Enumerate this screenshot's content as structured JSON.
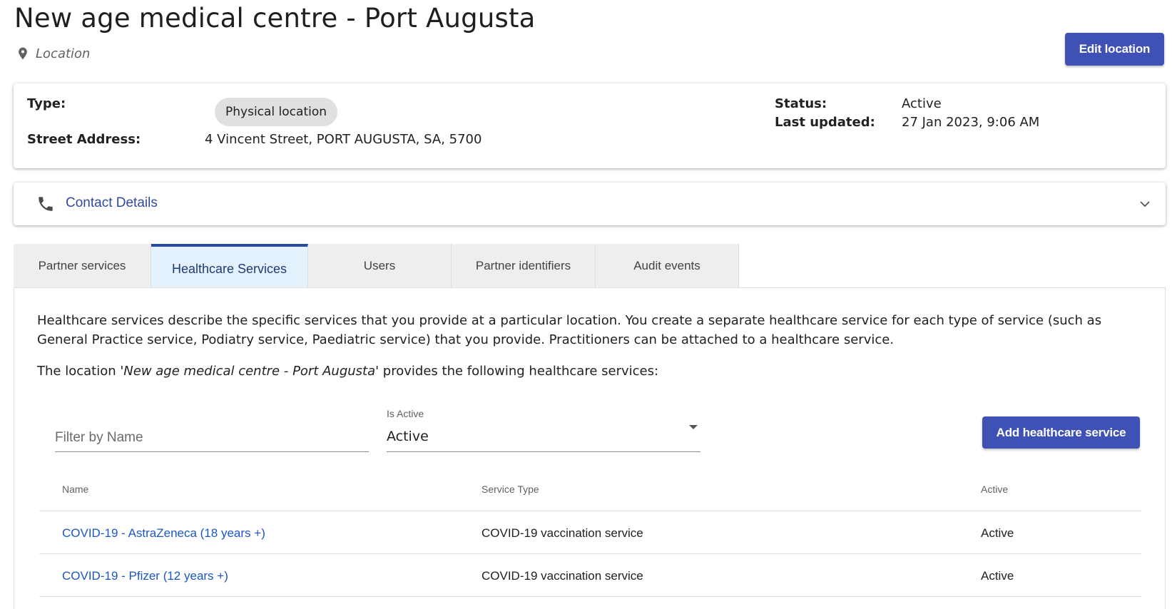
{
  "header": {
    "title": "New age medical centre - Port Augusta",
    "subtitle": "Location",
    "edit_button": "Edit location"
  },
  "info": {
    "type_label": "Type:",
    "type_value": "Physical location",
    "address_label": "Street Address:",
    "address_value": "4 Vincent Street, PORT AUGUSTA, SA, 5700",
    "status_label": "Status:",
    "status_value": "Active",
    "updated_label": "Last updated:",
    "updated_value": "27 Jan 2023, 9:06 AM"
  },
  "contact": {
    "label": "Contact Details"
  },
  "tabs": [
    {
      "label": "Partner services"
    },
    {
      "label": "Healthcare Services"
    },
    {
      "label": "Users"
    },
    {
      "label": "Partner identifiers"
    },
    {
      "label": "Audit events"
    }
  ],
  "active_tab": "Healthcare Services",
  "panel": {
    "description": "Healthcare services describe the specific services that you provide at a particular location. You create a separate healthcare service for each type of service (such as General Practice service, Podiatry service, Paediatric service) that you provide. Practitioners can be attached to a healthcare service.",
    "provides_prefix": "The location '",
    "provides_name": "New age medical centre - Port Augusta",
    "provides_suffix": "' provides the following healthcare services:",
    "filter_placeholder": "Filter by Name",
    "filter_value": "",
    "select_label": "Is Active",
    "select_value": "Active",
    "add_button": "Add healthcare service"
  },
  "table": {
    "columns": [
      "Name",
      "Service Type",
      "Active"
    ],
    "rows": [
      {
        "name": "COVID-19 - AstraZeneca (18 years +)",
        "service_type": "COVID-19 vaccination service",
        "active": "Active"
      },
      {
        "name": "COVID-19 - Pfizer (12 years +)",
        "service_type": "COVID-19 vaccination service",
        "active": "Active"
      }
    ]
  },
  "colors": {
    "primary": "#3f51b5",
    "link": "#1a56c4",
    "tab_active_bg": "#e3f2fd",
    "tab_active_border": "#2a4aa0"
  }
}
